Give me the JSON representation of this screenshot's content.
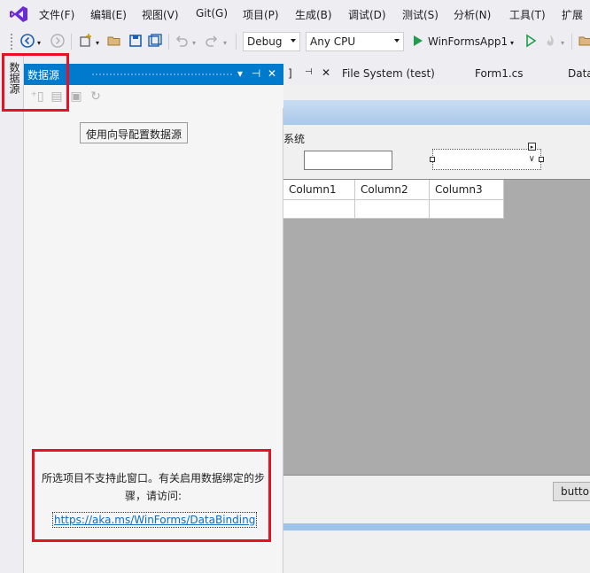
{
  "menu": {
    "items": [
      "文件(F)",
      "编辑(E)",
      "视图(V)",
      "Git(G)",
      "项目(P)",
      "生成(B)",
      "调试(D)",
      "测试(S)",
      "分析(N)",
      "工具(T)",
      "扩展"
    ]
  },
  "toolbar": {
    "configuration": "Debug",
    "platform": "Any CPU",
    "start_target": "WinFormsApp1"
  },
  "side_tabs": {
    "data_sources": "数据源"
  },
  "datasource_panel": {
    "title": "数据源",
    "wizard_button": "使用向导配置数据源",
    "message": "所选项目不支持此窗口。有关启用数据绑定的步骤，请访问:",
    "link": "https://aka.ms/WinForms/DataBinding"
  },
  "doc_tabs": [
    "File System (test)",
    "Form1.cs",
    "Data"
  ],
  "designer": {
    "partial_label": "系统",
    "grid_columns": [
      "Column1",
      "Column2",
      "Column3"
    ],
    "button_partial": "butto"
  },
  "colors": {
    "accent": "#007acc",
    "highlight_red": "#e81123",
    "vs_purple": "#6c2bd9",
    "run_green": "#1f9d4a"
  }
}
